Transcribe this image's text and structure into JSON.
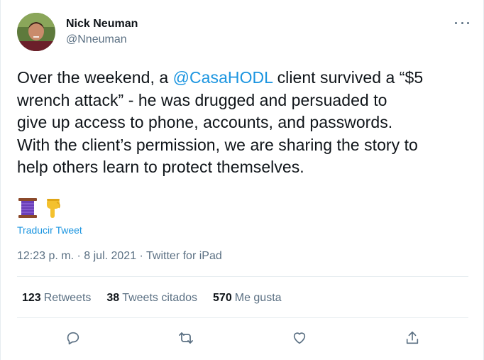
{
  "author": {
    "name": "Nick Neuman",
    "handle": "@Nneuman"
  },
  "tweet": {
    "text_before": "Over the weekend, a ",
    "mention": "@CasaHODL",
    "text_after": " client survived a “$5\nwrench attack” - he was drugged and persuaded to\ngive up access to phone, accounts, and passwords.\nWith the client’s permission, we are sharing the story to\nhelp others learn to protect themselves.",
    "emojis": [
      "thread-spool-emoji",
      "pointing-down-emoji"
    ],
    "translate_label": "Traducir Tweet",
    "timestamp": "12:23 p. m. · 8 jul. 2021 · Twitter for iPad"
  },
  "stats": {
    "retweets_count": "123",
    "retweets_label": "Retweets",
    "quotes_count": "38",
    "quotes_label": "Tweets citados",
    "likes_count": "570",
    "likes_label": "Me gusta"
  },
  "colors": {
    "accent": "#1b95e0",
    "secondary_text": "#5b7083",
    "border": "#e6ecf0"
  },
  "icons": {
    "more": "more-icon",
    "reply": "reply-icon",
    "retweet": "retweet-icon",
    "like": "like-icon",
    "share": "share-icon"
  }
}
